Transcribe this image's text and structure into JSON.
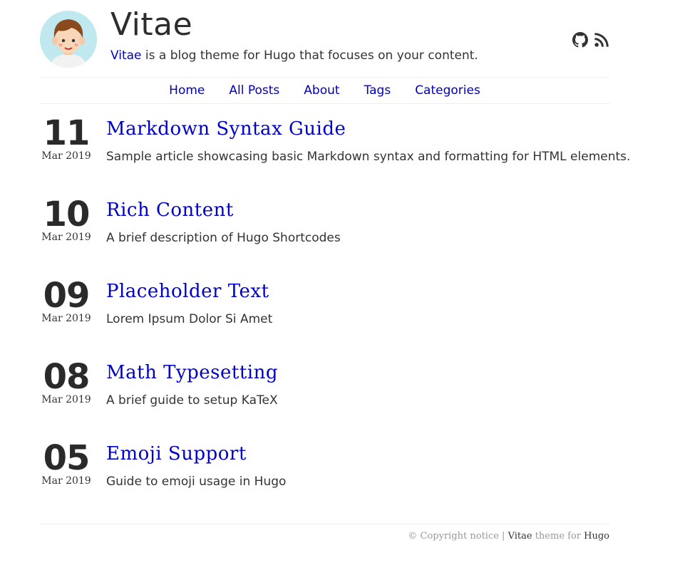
{
  "header": {
    "title": "Vitae",
    "tagline_link": "Vitae",
    "tagline_rest": " is a blog theme for Hugo that focuses on your content.",
    "social": [
      "github-icon",
      "rss-icon"
    ]
  },
  "nav": {
    "items": [
      "Home",
      "All Posts",
      "About",
      "Tags",
      "Categories"
    ]
  },
  "posts": [
    {
      "day": "11",
      "month": "Mar 2019",
      "title": "Markdown Syntax Guide",
      "desc": "Sample article showcasing basic Markdown syntax and formatting for HTML elements."
    },
    {
      "day": "10",
      "month": "Mar 2019",
      "title": "Rich Content",
      "desc": "A brief description of Hugo Shortcodes"
    },
    {
      "day": "09",
      "month": "Mar 2019",
      "title": "Placeholder Text",
      "desc": "Lorem Ipsum Dolor Si Amet"
    },
    {
      "day": "08",
      "month": "Mar 2019",
      "title": "Math Typesetting",
      "desc": "A brief guide to setup KaTeX"
    },
    {
      "day": "05",
      "month": "Mar 2019",
      "title": "Emoji Support",
      "desc": "Guide to emoji usage in Hugo"
    }
  ],
  "footer": {
    "copyright": "© Copyright notice | ",
    "theme_link": "Vitae",
    "theme_for": " theme for ",
    "hugo_link": "Hugo"
  },
  "colors": {
    "link": "#0000cc",
    "text": "#333333",
    "divider": "#eeeeee"
  }
}
